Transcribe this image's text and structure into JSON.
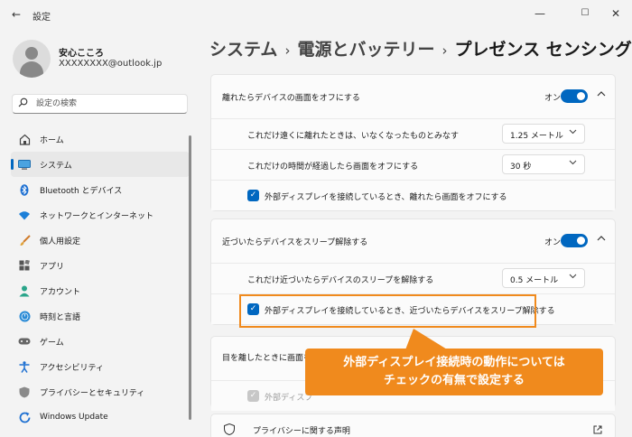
{
  "window": {
    "title": "設定",
    "back_glyph": "←",
    "minimize_glyph": "—",
    "maximize_glyph": "☐",
    "close_glyph": "✕"
  },
  "profile": {
    "name": "安心こころ",
    "email": "XXXXXXXX@outlook.jp"
  },
  "search": {
    "placeholder": "設定の検索"
  },
  "nav": {
    "items": [
      {
        "label": "ホーム",
        "icon": "home-icon"
      },
      {
        "label": "システム",
        "icon": "system-icon",
        "selected": true
      },
      {
        "label": "Bluetooth とデバイス",
        "icon": "bluetooth-icon"
      },
      {
        "label": "ネットワークとインターネット",
        "icon": "network-icon"
      },
      {
        "label": "個人用設定",
        "icon": "brush-icon"
      },
      {
        "label": "アプリ",
        "icon": "apps-icon"
      },
      {
        "label": "アカウント",
        "icon": "account-icon"
      },
      {
        "label": "時刻と言語",
        "icon": "time-language-icon"
      },
      {
        "label": "ゲーム",
        "icon": "gamepad-icon"
      },
      {
        "label": "アクセシビリティ",
        "icon": "accessibility-icon"
      },
      {
        "label": "プライバシーとセキュリティ",
        "icon": "shield-icon"
      },
      {
        "label": "Windows Update",
        "icon": "update-icon"
      }
    ]
  },
  "breadcrumb": {
    "part1": "システム",
    "part2": "電源とバッテリー",
    "current": "プレゼンス センシング",
    "sep": "›"
  },
  "card1": {
    "title": "離れたらデバイスの画面をオフにする",
    "toggle_label": "オン",
    "rows": {
      "distance": {
        "label": "これだけ遠くに離れたときは、いなくなったものとみなす",
        "value": "1.25 メートル"
      },
      "time": {
        "label": "これだけの時間が経過したら画面をオフにする",
        "value": "30 秒"
      },
      "check": {
        "label": "外部ディスプレイを接続しているとき、離れたら画面をオフにする"
      }
    }
  },
  "card2": {
    "title": "近づいたらデバイスをスリープ解除する",
    "toggle_label": "オン",
    "rows": {
      "distance": {
        "label": "これだけ近づいたらデバイスのスリープを解除する",
        "value": "0.5 メートル"
      },
      "check": {
        "label": "外部ディスプレイを接続しているとき、近づいたらデバイスをスリープ解除する"
      }
    }
  },
  "card3": {
    "title": "目を離したときに画面を暗",
    "check_label": "外部ディスプ"
  },
  "privacy": {
    "label": "プライバシーに関する声明"
  },
  "callout": {
    "line1": "外部ディスプレイ接続時の動作については",
    "line2": "チェックの有無で設定する"
  },
  "colors": {
    "accent": "#0067c0",
    "callout": "#f08a1d"
  }
}
